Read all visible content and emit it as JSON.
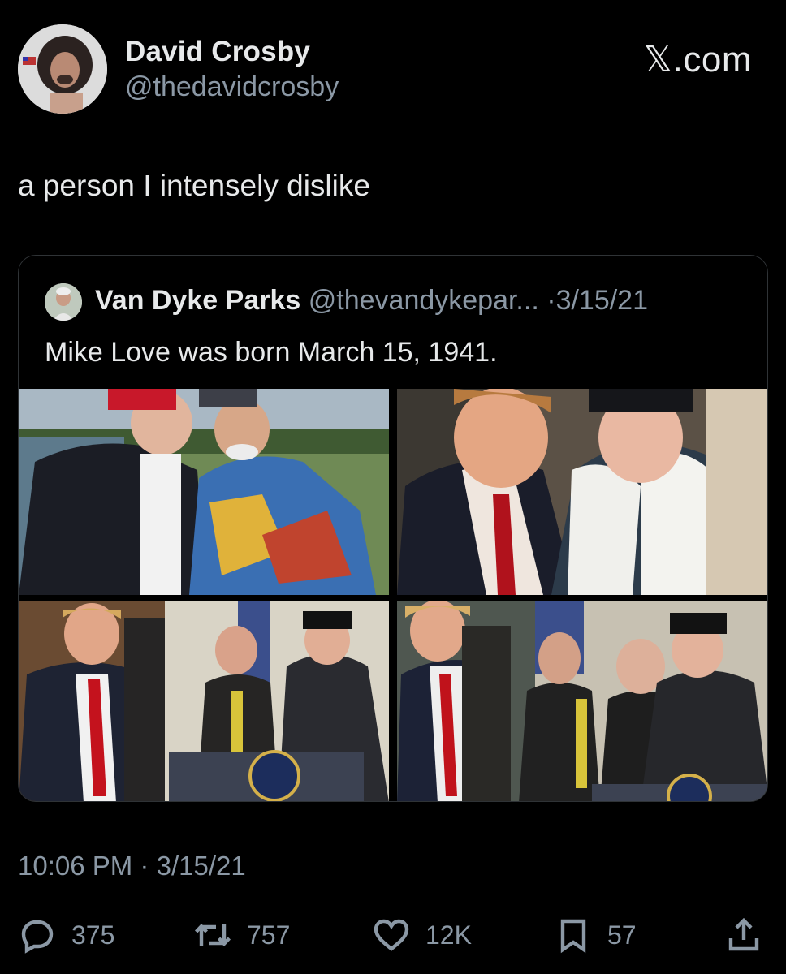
{
  "author": {
    "name": "David Crosby",
    "handle": "@thedavidcrosby"
  },
  "brand": "𝕏.com",
  "tweet": {
    "text": "a person I intensely dislike"
  },
  "quoted_tweet": {
    "author_name": "Van Dyke Parks",
    "author_handle": "@thevandykepar...",
    "separator": "·",
    "date": "3/15/21",
    "text": "Mike Love was born March 15, 1941.",
    "photos": [
      "photo-1",
      "photo-2",
      "photo-3",
      "photo-4"
    ]
  },
  "meta": {
    "time": "10:06 PM",
    "separator": "·",
    "date": "3/15/21"
  },
  "actions": {
    "reply": {
      "icon": "reply-icon",
      "count": "375"
    },
    "retweet": {
      "icon": "retweet-icon",
      "count": "757"
    },
    "like": {
      "icon": "heart-icon",
      "count": "12K"
    },
    "bookmark": {
      "icon": "bookmark-icon",
      "count": "57"
    },
    "share": {
      "icon": "share-icon"
    }
  },
  "colors": {
    "background": "#000000",
    "text_primary": "#e7e9ea",
    "text_secondary": "#8b98a5",
    "border": "#2f3336"
  }
}
